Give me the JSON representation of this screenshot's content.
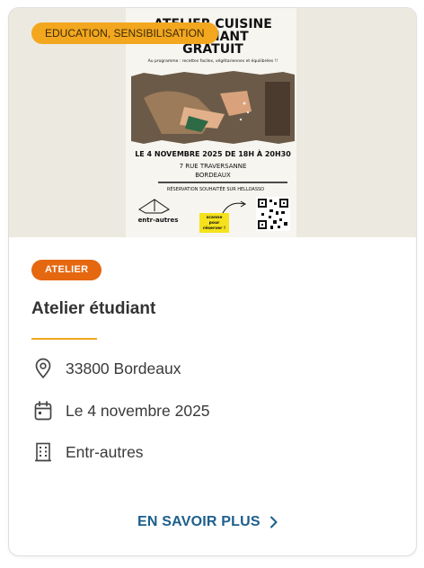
{
  "card": {
    "category_tag": "EDUCATION, SENSIBILISATION",
    "image": {
      "poster_title_lines": [
        "ATELIER CUISINE",
        "ÉTUDIANT",
        "GRATUIT"
      ],
      "poster_subtitle": "Au programme : recettes faciles, végétariennes et équilibrées !!",
      "poster_date": "LE 4 NOVEMBRE 2025 DE 18H À 20H30",
      "poster_address_line1": "7 RUE TRAVERSANNE",
      "poster_address_line2": "BORDEAUX",
      "poster_reservation": "RÉSERVATION SOUHAITÉE SUR HELLOASSO",
      "poster_logo": "entr-autres",
      "poster_scan_lines": [
        "scanne",
        "pour",
        "réserver !"
      ]
    },
    "type_badge": "ATELIER",
    "title": "Atelier étudiant",
    "details": {
      "location": "33800 Bordeaux",
      "date": "Le 4 novembre 2025",
      "organizer": "Entr-autres"
    },
    "cta_label": "EN SAVOIR PLUS"
  },
  "colors": {
    "accent_yellow": "#f3a71e",
    "badge_orange": "#e5670f",
    "link_blue": "#1c5f8c",
    "title_text": "#333333"
  },
  "icons": [
    "map-pin-icon",
    "calendar-icon",
    "building-icon",
    "chevron-right-icon",
    "qr-code-icon",
    "paper-boat-icon",
    "curved-arrow-icon"
  ]
}
